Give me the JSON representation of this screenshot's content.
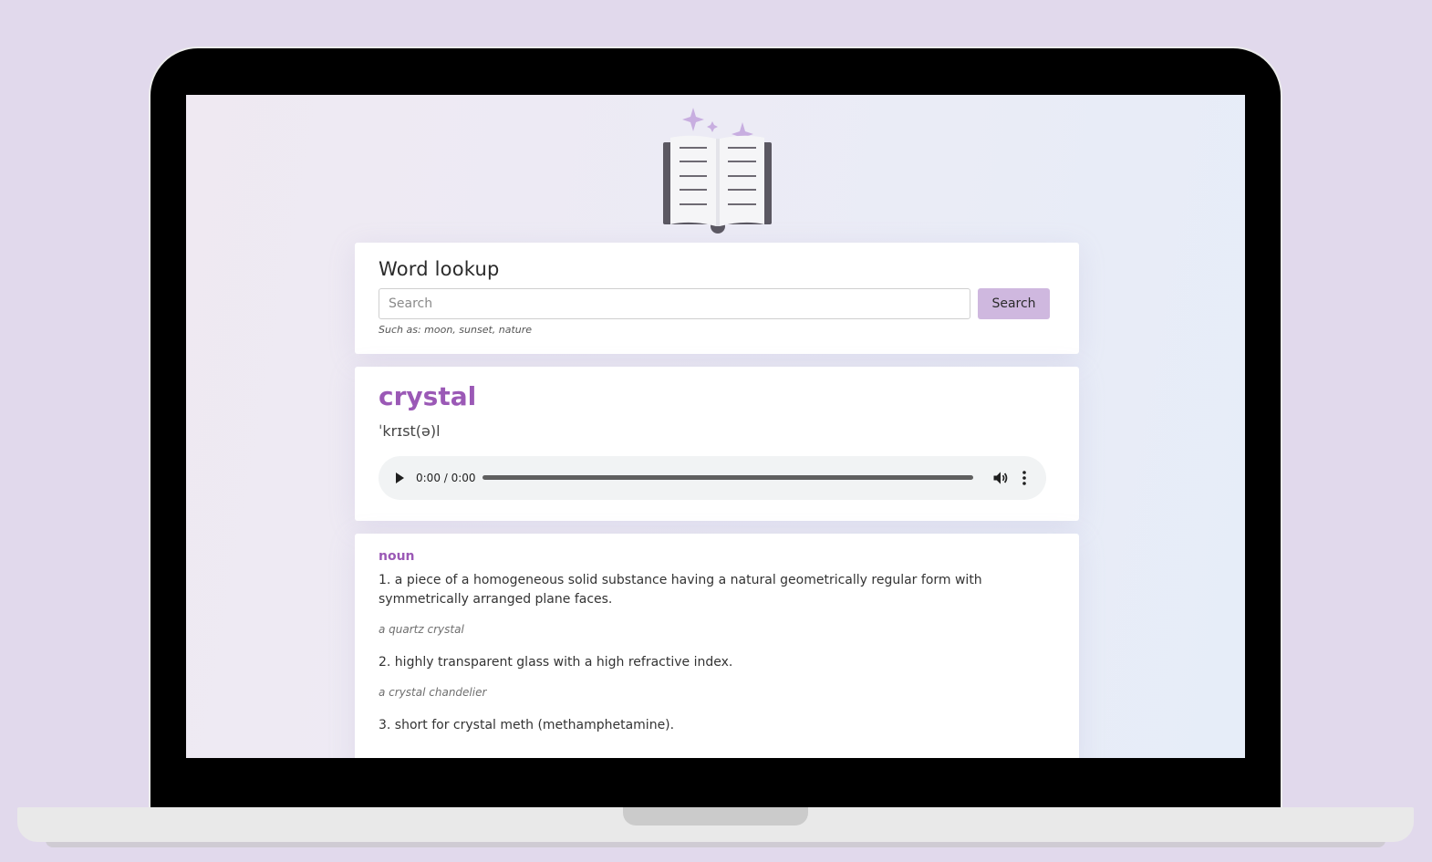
{
  "search": {
    "title": "Word lookup",
    "placeholder": "Search",
    "button_label": "Search",
    "hint": "Such as: moon, sunset, nature"
  },
  "entry": {
    "word": "crystal",
    "phonetic": "ˈkrɪst(ə)l",
    "audio": {
      "time": "0:00 / 0:00",
      "progress": 0
    }
  },
  "meaning": {
    "part_of_speech": "noun",
    "definitions": [
      {
        "text": "1. a piece of a homogeneous solid substance having a natural geometrically regular form with symmetrically arranged plane faces.",
        "example": "a quartz crystal"
      },
      {
        "text": "2. highly transparent glass with a high refractive index.",
        "example": "a crystal chandelier"
      },
      {
        "text": "3. short for crystal meth (methamphetamine).",
        "example": ""
      }
    ]
  },
  "colors": {
    "page_background": "#e1d9ec",
    "accent": "#9b59b6",
    "button": "#cfb8df",
    "sparkle": "#c8aee0",
    "book_cover": "#5b5862"
  },
  "icons": {
    "logo": "open-book-icon",
    "sparkles": "sparkle-icon",
    "play": "play-icon",
    "volume": "volume-icon",
    "menu": "more-vertical-icon"
  }
}
